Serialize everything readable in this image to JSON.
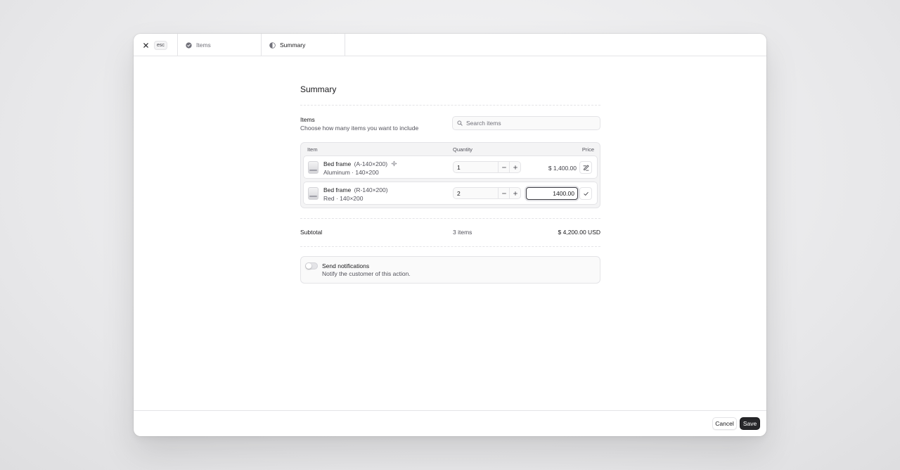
{
  "topbar": {
    "esc_label": "esc",
    "tabs": [
      {
        "label": "Items",
        "status": "completed"
      },
      {
        "label": "Summary",
        "status": "in-progress"
      }
    ]
  },
  "page": {
    "title": "Summary"
  },
  "items_section": {
    "title": "Items",
    "description": "Choose how many items you want to include",
    "search": {
      "placeholder": "Search items",
      "value": ""
    }
  },
  "table": {
    "headers": {
      "item": "Item",
      "quantity": "Quantity",
      "price": "Price"
    },
    "rows": [
      {
        "name": "Bed frame",
        "sku": "(A-140×200)",
        "variant": "Aluminum · 140×200",
        "quantity": "1",
        "price": "$ 1,400.00",
        "editing": false,
        "action_icon": "edit-price-icon"
      },
      {
        "name": "Bed frame",
        "sku": "(R-140×200)",
        "variant": "Red · 140×200",
        "quantity": "2",
        "price_input": "1400.00",
        "editing": true,
        "action_icon": "check-icon"
      }
    ]
  },
  "subtotal": {
    "label": "Subtotal",
    "count": "3 items",
    "value": "$ 4,200.00 USD"
  },
  "notifications": {
    "title": "Send notifications",
    "description": "Notify the customer of this action.",
    "enabled": false
  },
  "footer": {
    "cancel_label": "Cancel",
    "save_label": "Save"
  },
  "colors": {
    "primary_button": "#27272a",
    "border": "#e4e4e7",
    "muted_text": "#52525b"
  }
}
